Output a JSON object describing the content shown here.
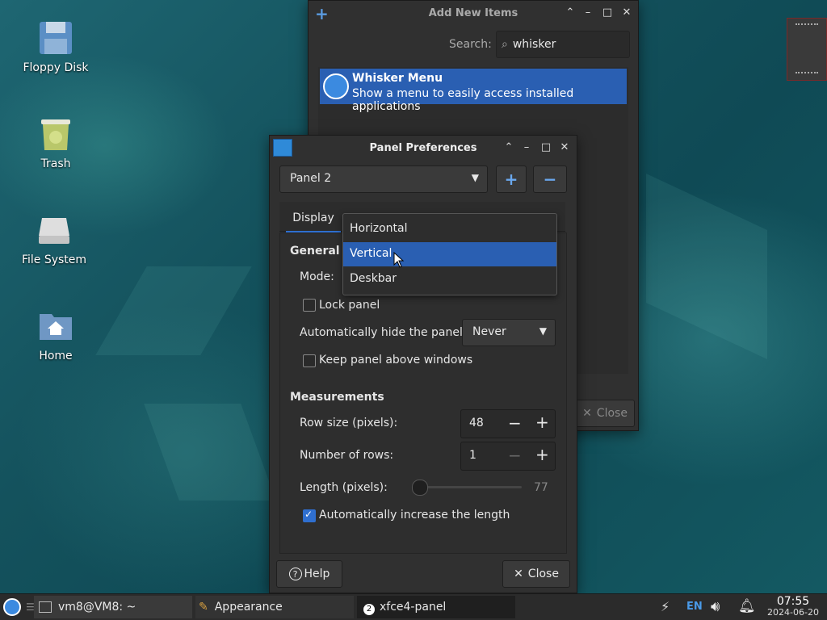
{
  "desktop": {
    "icons": [
      {
        "label": "Floppy Disk"
      },
      {
        "label": "Trash"
      },
      {
        "label": "File System"
      },
      {
        "label": "Home"
      }
    ]
  },
  "add_items_window": {
    "title": "Add New Items",
    "search_label": "Search:",
    "search_value": "whisker",
    "result_name": "Whisker Menu",
    "result_desc": "Show a menu to easily access installed applications",
    "close_label": "Close"
  },
  "panel_prefs": {
    "title": "Panel Preferences",
    "panel_select": "Panel 2",
    "tab_display": "Display",
    "section_general": "General",
    "mode_label": "Mode:",
    "mode_options": [
      "Horizontal",
      "Vertical",
      "Deskbar"
    ],
    "lock_panel": "Lock panel",
    "auto_hide_label": "Automatically hide the panel:",
    "auto_hide_value": "Never",
    "keep_above": "Keep panel above windows",
    "section_measurements": "Measurements",
    "row_size_label": "Row size (pixels):",
    "row_size_value": "48",
    "num_rows_label": "Number of rows:",
    "num_rows_value": "1",
    "length_label": "Length (pixels):",
    "length_value": "77",
    "auto_increase": "Automatically increase the length",
    "help_label": "Help",
    "close_label": "Close"
  },
  "taskbar": {
    "tasks": [
      {
        "label": "vm8@VM8: ~"
      },
      {
        "label": "Appearance"
      },
      {
        "label": "xfce4-panel",
        "badge": "2"
      }
    ],
    "lang": "EN",
    "time": "07:55",
    "date": "2024-06-20"
  },
  "colors": {
    "accent": "#2a5fb2",
    "window_bg": "#303030"
  }
}
